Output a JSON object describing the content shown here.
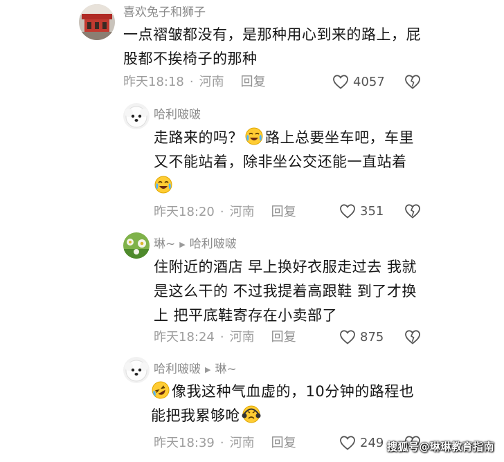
{
  "comments": [
    {
      "username": "喜欢兔子和狮子",
      "lines": [
        "一点褶皱都没有，是那种用心到来的路上，屁",
        "股都不挨椅子的那种"
      ],
      "time": "昨天18:18",
      "location": "河南",
      "reply": "回复",
      "likes": "4057"
    },
    {
      "username": "哈利啵啵",
      "line1_a": "走路来的吗？",
      "line1_b": "路上总要坐车吧，车里",
      "line2": "又不能站着，除非坐公交还能一直站着",
      "time": "昨天18:20",
      "location": "河南",
      "reply": "回复",
      "likes": "351"
    },
    {
      "username": "琳~",
      "reply_to": "哈利啵啵",
      "lines": [
        "住附近的酒店 早上换好衣服走过去 我就",
        "是这么干的 不过我提着高跟鞋 到了才换",
        "上 把平底鞋寄存在小卖部了"
      ],
      "time": "昨天18:24",
      "location": "河南",
      "reply": "回复",
      "likes": "875"
    },
    {
      "username": "哈利啵啵",
      "reply_to": "琳~",
      "line1": "像我这种气血虚的，10分钟的路程也",
      "line2": "能把我累够呛",
      "time": "昨天18:39",
      "location": "河南",
      "reply": "回复",
      "likes": "249"
    }
  ],
  "meta_separator": "·",
  "watermark": "搜狐号@琳琳教育指南",
  "icons": {
    "like": "heart-outline-icon",
    "dislike": "broken-heart-icon",
    "reply_arrow": "play-triangle-icon",
    "emoji_crying": "crying-laughing-emoji-icon",
    "emoji_rolling": "rolling-laughing-emoji-icon",
    "emoji_frown": "frowning-emoji-icon"
  }
}
